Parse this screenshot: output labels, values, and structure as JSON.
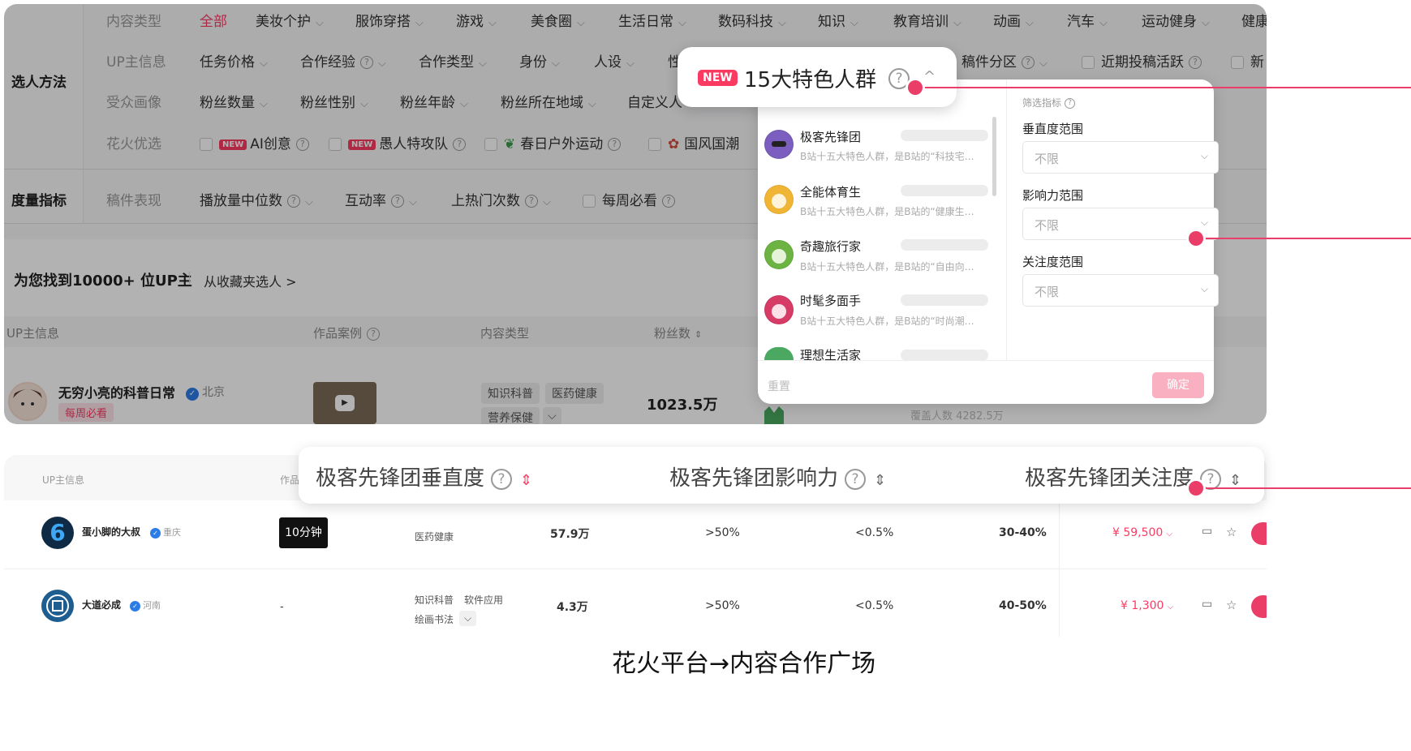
{
  "filters": {
    "row_labels": {
      "method": "选人方法",
      "metric": "度量指标"
    },
    "content_type": {
      "label": "内容类型",
      "items": [
        "全部",
        "美妆个护",
        "服饰穿搭",
        "游戏",
        "美食圈",
        "生活日常",
        "数码科技",
        "知识",
        "教育培训",
        "动画",
        "汽车",
        "运动健身",
        "健康"
      ]
    },
    "up_info": {
      "label": "UP主信息",
      "items": [
        "任务价格",
        "合作经验",
        "合作类型",
        "身份",
        "人设",
        "性",
        "稿件分区",
        "近期投稿活跃",
        "新"
      ]
    },
    "audience": {
      "label": "受众画像",
      "items": [
        "粉丝数量",
        "粉丝性别",
        "粉丝年龄",
        "粉丝所在地域",
        "自定义人"
      ]
    },
    "huahuo": {
      "label": "花火优选",
      "items": [
        "AI创意",
        "愚人特攻队",
        "春日户外运动",
        "国风国潮"
      ],
      "new_badge": "NEW"
    },
    "metric": {
      "label": "稿件表现",
      "items": [
        "播放量中位数",
        "互动率",
        "上热门次数",
        "每周必看"
      ]
    }
  },
  "results": {
    "count_text": "为您找到10000+ 位UP主",
    "collect_link": "从收藏夹选人 >"
  },
  "table1": {
    "headers": [
      "UP主信息",
      "作品案例",
      "内容类型",
      "粉丝数"
    ],
    "row": {
      "name": "无穷小亮的科普日常",
      "location": "北京",
      "badge": "每周必看",
      "tags": [
        "知识科普",
        "医药健康",
        "营养保健"
      ],
      "fans": "1023.5万"
    },
    "extra_row_name": "理想生活家",
    "extra_row_note": "覆盖人数 4282.5万"
  },
  "popup": {
    "new_badge": "NEW",
    "title": "15大特色人群",
    "help": "?",
    "chevron": "^",
    "groups": [
      {
        "name": "极客先锋团",
        "desc": "B站十五大特色人群，是B站的“科技宅…"
      },
      {
        "name": "全能体育生",
        "desc": "B站十五大特色人群，是B站的“健康生…"
      },
      {
        "name": "奇趣旅行家",
        "desc": "B站十五大特色人群，是B站的“自由向…"
      },
      {
        "name": "时髦多面手",
        "desc": "B站十五大特色人群，是B站的“时尚潮…"
      },
      {
        "name": "理想生活家",
        "desc": ""
      }
    ],
    "filter_title": "筛选指标",
    "fields": [
      {
        "label": "垂直度范围",
        "value": "不限"
      },
      {
        "label": "影响力范围",
        "value": "不限"
      },
      {
        "label": "关注度范围",
        "value": "不限"
      }
    ],
    "reset": "重置",
    "confirm": "确定"
  },
  "table2": {
    "headers": {
      "up": "UP主信息",
      "works": "作品"
    },
    "zoom_headers": [
      "极客先锋团垂直度",
      "极客先锋团影响力",
      "极客先锋团关注度"
    ],
    "rows": [
      {
        "name": "蛋小脚的大叔",
        "location": "重庆",
        "work": "10分钟",
        "tags": [
          "医药健康"
        ],
        "fans": "57.9万",
        "v1": ">50%",
        "v2": "<0.5%",
        "v3": "30-40%",
        "price": "¥ 59,500"
      },
      {
        "name": "大道必成",
        "location": "河南",
        "work": "-",
        "tags": [
          "知识科普",
          "软件应用",
          "绘画书法"
        ],
        "fans": "4.3万",
        "v1": ">50%",
        "v2": "<0.5%",
        "v3": "40-50%",
        "price": "¥ 1,300"
      }
    ]
  },
  "caption": "花火平台→内容合作广场",
  "colors": {
    "accent": "#fb3a62",
    "highlight_dot": "#ea3d68",
    "dim_overlay": "rgba(0,0,0,0.30)"
  }
}
